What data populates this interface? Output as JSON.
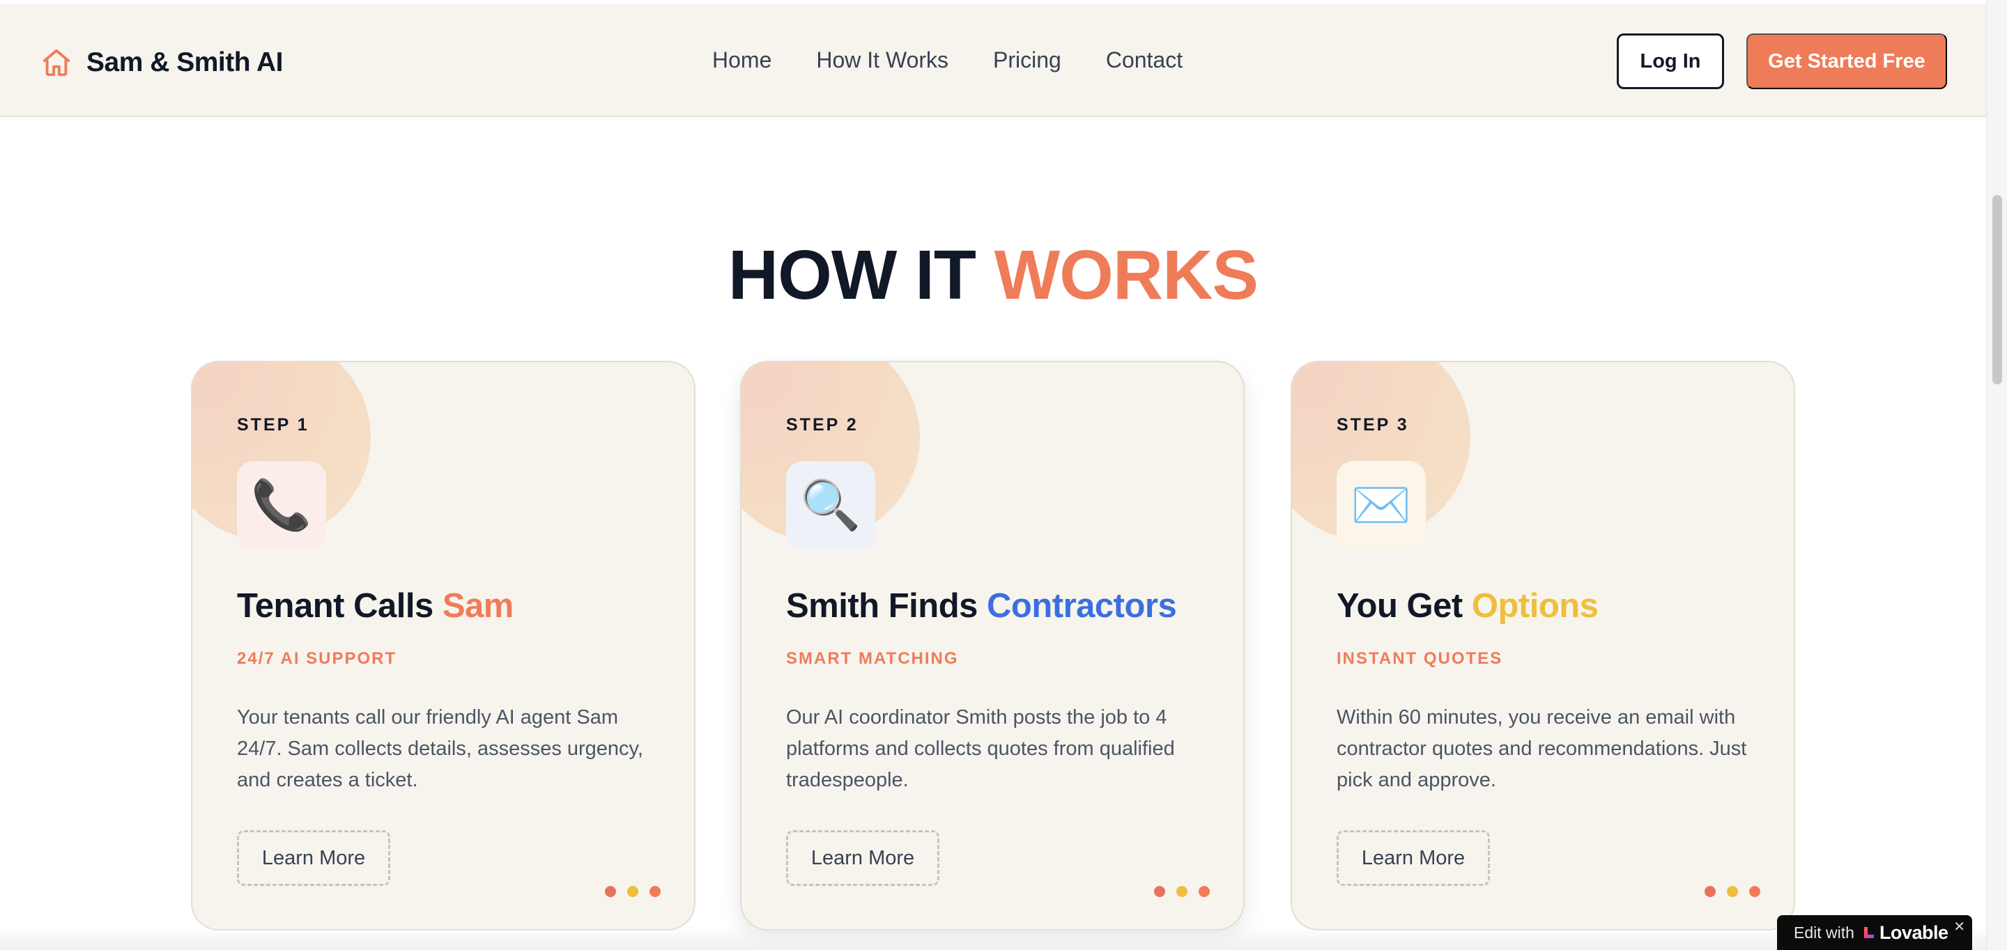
{
  "nav": {
    "brand": "Sam & Smith AI",
    "brand_icon": "home-icon",
    "links": [
      "Home",
      "How It Works",
      "Pricing",
      "Contact"
    ],
    "login_label": "Log In",
    "cta_label": "Get Started Free"
  },
  "section": {
    "title_part1": "HOW IT",
    "title_part2": "WORKS"
  },
  "cards": [
    {
      "step": "STEP 1",
      "icon": "phone-icon",
      "icon_glyph": "📞",
      "title_main": "Tenant Calls",
      "title_accent": "Sam",
      "subtitle": "24/7 AI SUPPORT",
      "description": "Your tenants call our friendly AI agent Sam 24/7. Sam collects details, assesses urgency, and creates a ticket.",
      "button": "Learn More"
    },
    {
      "step": "STEP 2",
      "icon": "magnifier-icon",
      "icon_glyph": "🔍",
      "title_main": "Smith Finds",
      "title_accent": "Contractors",
      "subtitle": "SMART MATCHING",
      "description": "Our AI coordinator Smith posts the job to 4 platforms and collects quotes from qualified tradespeople.",
      "button": "Learn More"
    },
    {
      "step": "STEP 3",
      "icon": "envelope-icon",
      "icon_glyph": "✉️",
      "title_main": "You Get",
      "title_accent": "Options",
      "subtitle": "INSTANT QUOTES",
      "description": "Within 60 minutes, you receive an email with contractor quotes and recommendations. Just pick and approve.",
      "button": "Learn More"
    }
  ],
  "badge": {
    "prefix": "Edit with",
    "brand": "Lovable",
    "close": "✕"
  },
  "colors": {
    "accent": "#ef7c59",
    "blue": "#3b6fe0",
    "yellow": "#f0bd3c",
    "dark": "#111827",
    "card_bg": "#f7f4ee"
  }
}
